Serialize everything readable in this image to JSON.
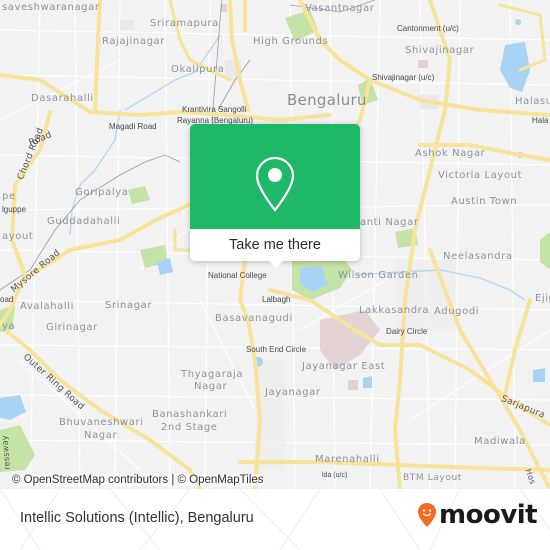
{
  "map": {
    "city_label": "Bengaluru",
    "area_labels": [
      {
        "id": "basaveshwaranagar",
        "text": "saveshwaranagar"
      },
      {
        "id": "sriramapura",
        "text": "Sriramapura"
      },
      {
        "id": "rajajinagar",
        "text": "Rajajinagar"
      },
      {
        "id": "vasantnagar",
        "text": "Vasantnagar"
      },
      {
        "id": "high-grounds",
        "text": "High Grounds"
      },
      {
        "id": "okalipura",
        "text": "Okalipura"
      },
      {
        "id": "shivajinagar",
        "text": "Shivajinagar"
      },
      {
        "id": "dasarahalli",
        "text": "Dasarahalli"
      },
      {
        "id": "halasuru",
        "text": "Halasu"
      },
      {
        "id": "ashok-nagar",
        "text": "Ashok Nagar"
      },
      {
        "id": "victoria-layout",
        "text": "Victoria Layout"
      },
      {
        "id": "goripalya",
        "text": "Goripalya"
      },
      {
        "id": "austin-town",
        "text": "Austin Town"
      },
      {
        "id": "guddadahalli",
        "text": "Guddadahalli"
      },
      {
        "id": "shanti-nagar",
        "text": "anti Nagar"
      },
      {
        "id": "neelasandra",
        "text": "Neelasandra"
      },
      {
        "id": "wilson-garden",
        "text": "Wilson Garden"
      },
      {
        "id": "avalahalli",
        "text": "Avalahalli"
      },
      {
        "id": "srinagar",
        "text": "Srinagar"
      },
      {
        "id": "ejipura",
        "text": "Ejip"
      },
      {
        "id": "lakkasandra",
        "text": "Lakkasandra"
      },
      {
        "id": "adugodi",
        "text": "Adugodi"
      },
      {
        "id": "basavanagudi",
        "text": "Basavanagudi"
      },
      {
        "id": "girinagar",
        "text": "Girinagar"
      },
      {
        "id": "thyagaraja-nagar",
        "text": "Thyagaraja"
      },
      {
        "id": "thyagaraja-nagar-2",
        "text": "Nagar"
      },
      {
        "id": "jayanagar-east",
        "text": "Jayanagar East"
      },
      {
        "id": "jayanagar",
        "text": "Jayanagar"
      },
      {
        "id": "banashankari",
        "text": "Banashankari"
      },
      {
        "id": "banashankari-2",
        "text": "2nd Stage"
      },
      {
        "id": "bhuvaneshwari",
        "text": "Bhuvaneshwari"
      },
      {
        "id": "bhuvaneshwari-2",
        "text": "Nagar"
      },
      {
        "id": "madiwala",
        "text": "Madiwala"
      },
      {
        "id": "marenahalli",
        "text": "Marenahalli"
      },
      {
        "id": "btm-layout",
        "text": "BTM Layout"
      },
      {
        "id": "layout-left",
        "text": "ayout"
      },
      {
        "id": "nya-left",
        "text": "ya"
      },
      {
        "id": "pe-left",
        "text": "pe"
      }
    ],
    "poi_labels": [
      {
        "id": "cantonment",
        "text": "Cantonment (u/c)"
      },
      {
        "id": "shivajinagar-uc",
        "text": "Shivajinagar (u/c)"
      },
      {
        "id": "krantivira-1",
        "text": "Krantivira Sangolli"
      },
      {
        "id": "krantivira-2",
        "text": "Rayanna (Bengaluru)"
      },
      {
        "id": "magadi-road-stn",
        "text": "Magadi Road"
      },
      {
        "id": "halasuru-stn",
        "text": "Hala"
      },
      {
        "id": "nalguppe",
        "text": "lguppe"
      },
      {
        "id": "national-college",
        "text": "National College"
      },
      {
        "id": "lalbagh",
        "text": "Lalbagh"
      },
      {
        "id": "south-end-circle",
        "text": "South End Circle"
      },
      {
        "id": "dairy-circle",
        "text": "Dairy Circle"
      },
      {
        "id": "road-left",
        "text": "oad"
      },
      {
        "id": "lda-uc",
        "text": "lda (u/c)"
      }
    ],
    "road_labels": [
      {
        "id": "chord-road",
        "text": "Chord Road"
      },
      {
        "id": "mysore-road",
        "text": "Mysore Road"
      },
      {
        "id": "outer-ring-road",
        "text": "Outer Ring Road"
      },
      {
        "id": "sarjapura",
        "text": "Sarjapura"
      },
      {
        "id": "road-top-left",
        "text": "Road"
      },
      {
        "id": "expressway",
        "text": "ressway"
      },
      {
        "id": "hosur",
        "text": "Hos"
      }
    ],
    "colors": {
      "road": "#f8e39a",
      "water": "#a9d3f5",
      "park": "#c4e3a6",
      "land": "#f2f2f3"
    }
  },
  "popup": {
    "icon": "map-pin-icon",
    "cta_label": "Take me there",
    "color": "#1fb868"
  },
  "attribution": "© OpenStreetMap contributors | © OpenMapTiles",
  "footer": {
    "place_name": "Intellic Solutions (Intellic), Bengaluru",
    "brand": "moovit",
    "brand_color": "#f26c22"
  }
}
